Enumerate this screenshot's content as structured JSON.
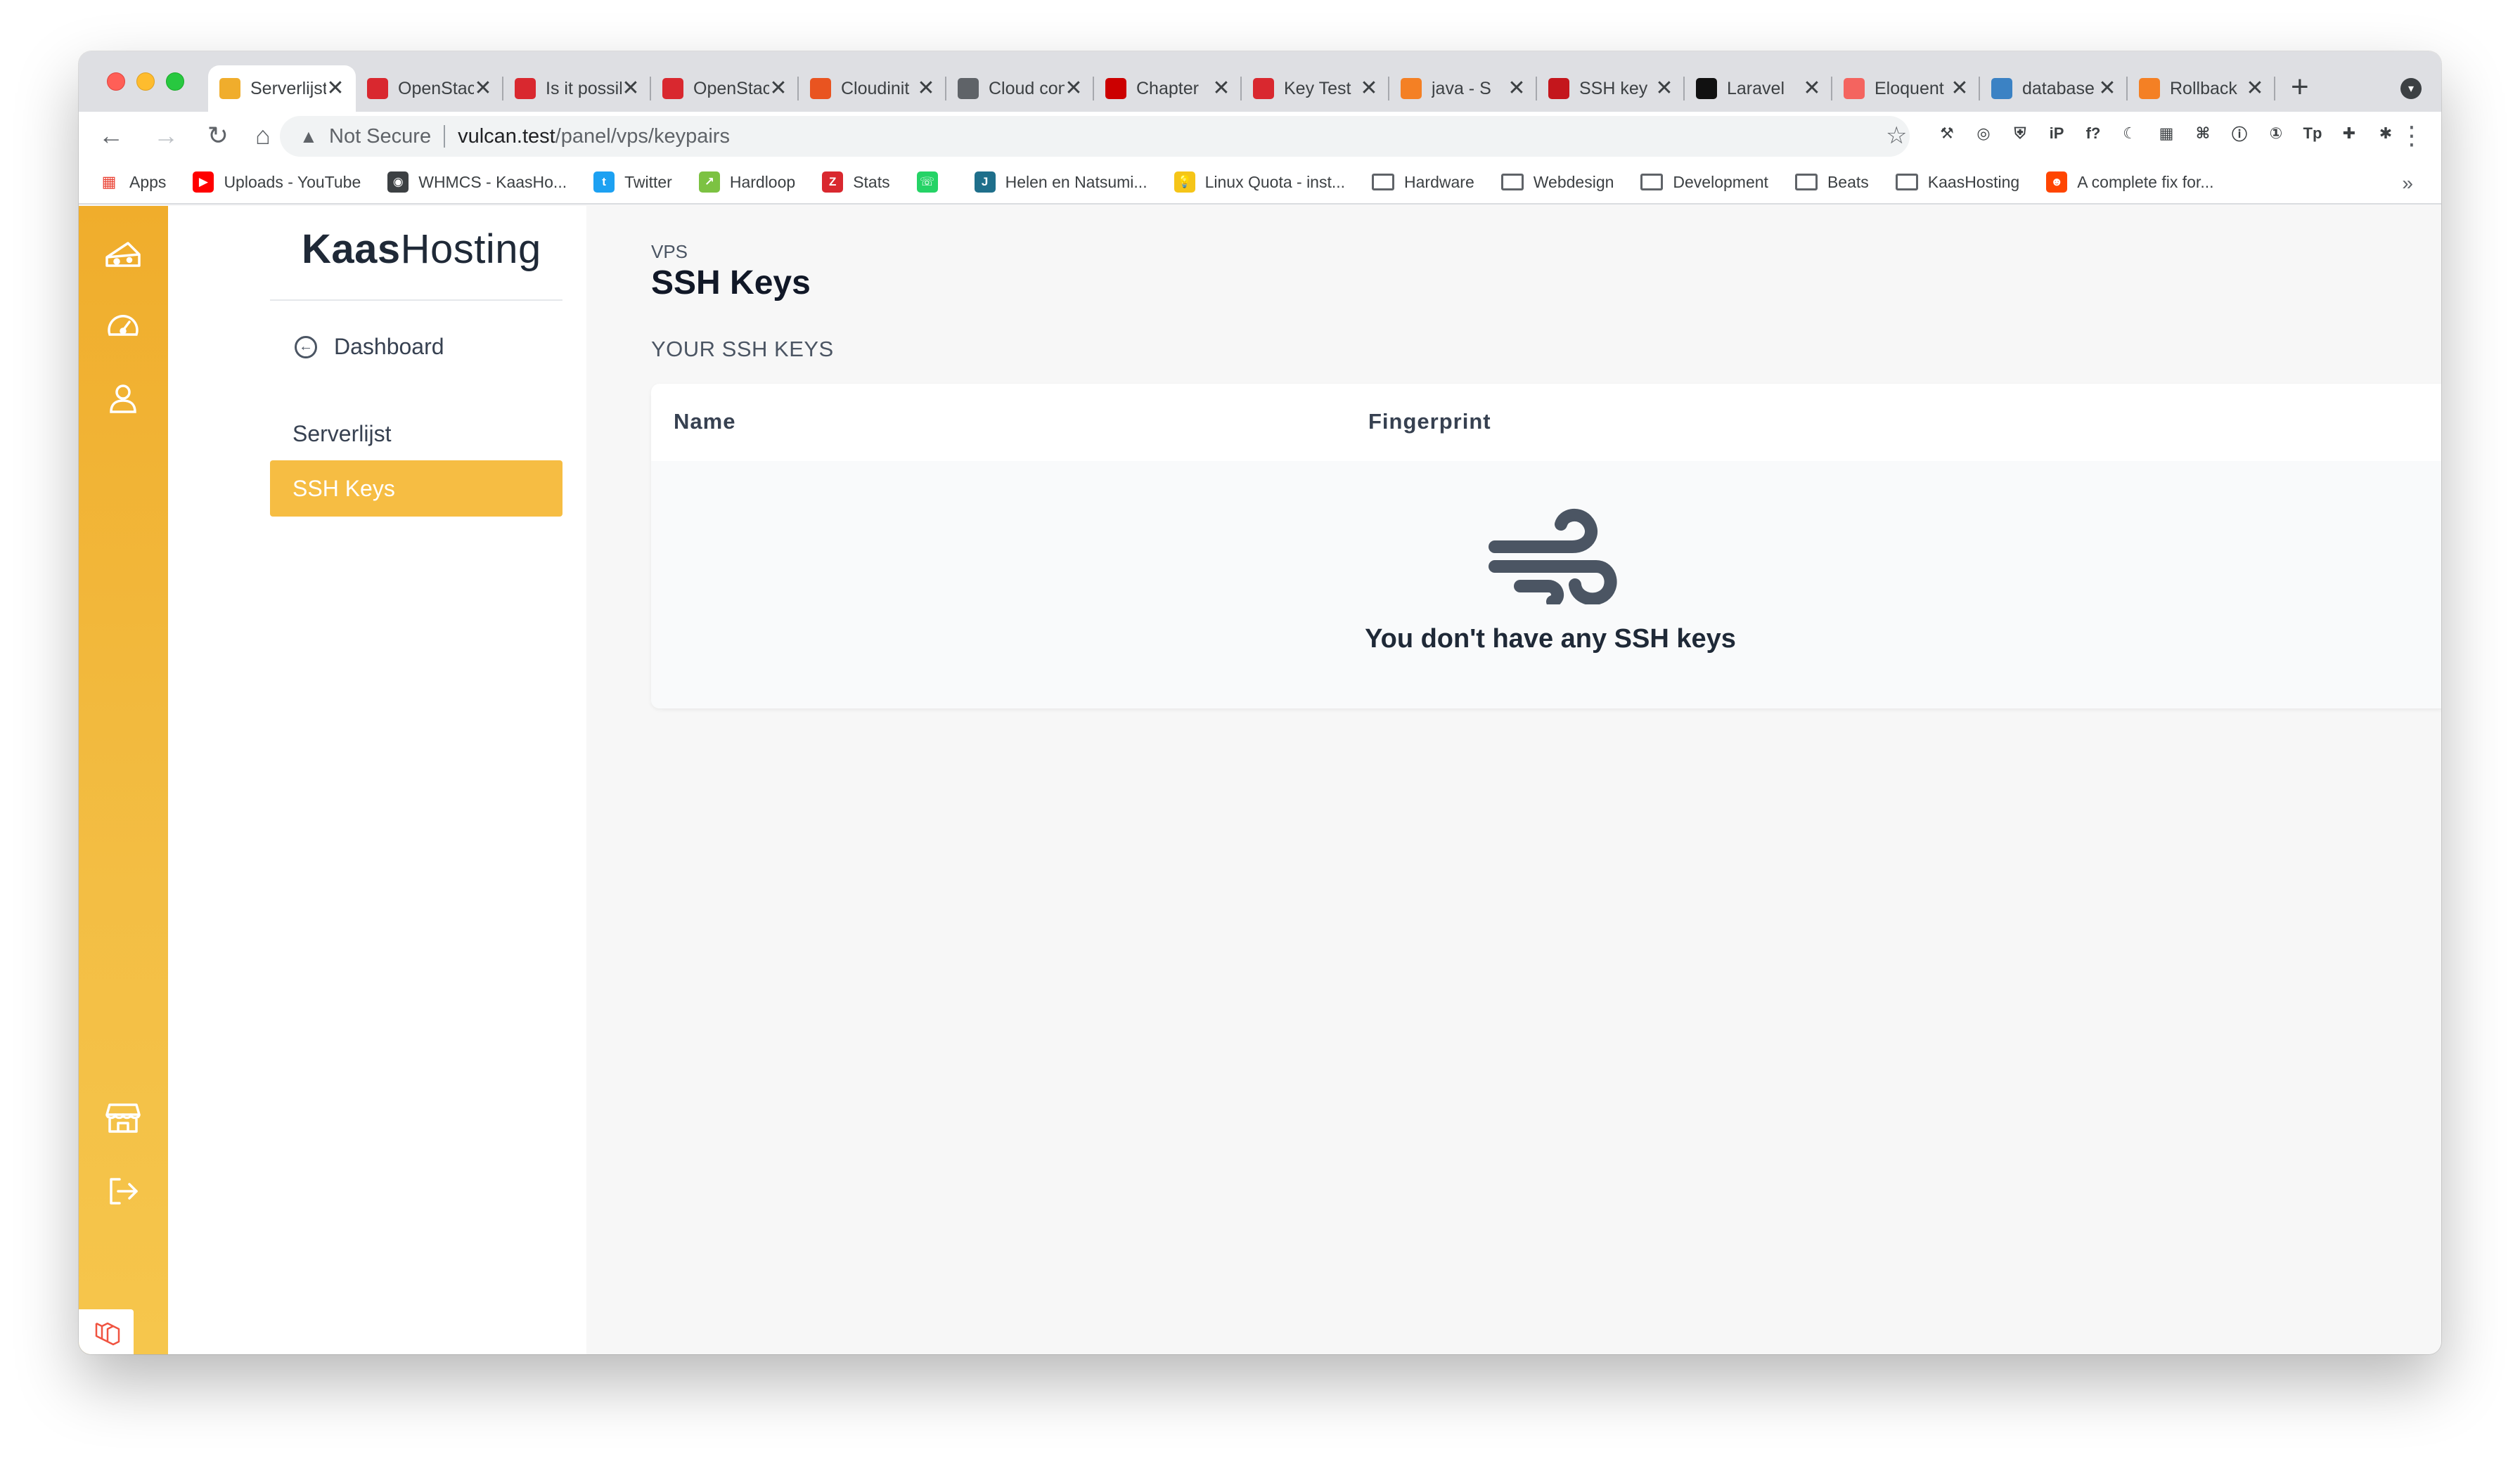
{
  "browser": {
    "tabs": [
      {
        "title": "Serverlijst",
        "favicon_color": "#f0ad2c",
        "active": true
      },
      {
        "title": "OpenStack",
        "favicon_color": "#d9282f",
        "active": false
      },
      {
        "title": "Is it possible",
        "favicon_color": "#d9282f",
        "active": false
      },
      {
        "title": "OpenStack",
        "favicon_color": "#d9282f",
        "active": false
      },
      {
        "title": "Cloudinit",
        "favicon_color": "#e95420",
        "active": false
      },
      {
        "title": "Cloud config",
        "favicon_color": "#5f6368",
        "active": false
      },
      {
        "title": "Chapter",
        "favicon_color": "#cc0000",
        "active": false
      },
      {
        "title": "Key Test",
        "favicon_color": "#d9282f",
        "active": false
      },
      {
        "title": "java - S",
        "favicon_color": "#f48024",
        "active": false
      },
      {
        "title": "SSH key",
        "favicon_color": "#c4161c",
        "active": false
      },
      {
        "title": "Laravel",
        "favicon_color": "#111111",
        "active": false
      },
      {
        "title": "Eloquent",
        "favicon_color": "#f4645f",
        "active": false
      },
      {
        "title": "database",
        "favicon_color": "#3b82c4",
        "active": false
      },
      {
        "title": "Rollback",
        "favicon_color": "#f48024",
        "active": false
      }
    ],
    "tab_close_glyph": "✕",
    "new_tab_glyph": "+",
    "address": {
      "security_label": "Not Secure",
      "host": "vulcan.test",
      "path": "/panel/vps/keypairs"
    },
    "extensions": [
      "⚒",
      "◎",
      "⛨",
      "iP",
      "f?",
      "☾",
      "▦",
      "⌘",
      "ⓘ",
      "①",
      "Tp",
      "✚",
      "✱"
    ],
    "bookmarks": [
      {
        "label": "Apps",
        "kind": "apps",
        "color": "#ea4335"
      },
      {
        "label": "Uploads - YouTube",
        "kind": "icon",
        "color": "#ff0000",
        "glyph": "▶"
      },
      {
        "label": "WHMCS - KaasHo...",
        "kind": "icon",
        "color": "#3c4043",
        "glyph": "◉"
      },
      {
        "label": "Twitter",
        "kind": "icon",
        "color": "#1da1f2",
        "glyph": "t"
      },
      {
        "label": "Hardloop",
        "kind": "icon",
        "color": "#7cc242",
        "glyph": "↗"
      },
      {
        "label": "Stats",
        "kind": "icon",
        "color": "#d9282f",
        "glyph": "Z"
      },
      {
        "label": "",
        "kind": "icon",
        "color": "#25d366",
        "glyph": "☏"
      },
      {
        "label": "Helen en Natsumi...",
        "kind": "icon",
        "color": "#1f6f8b",
        "glyph": "J"
      },
      {
        "label": "Linux Quota - inst...",
        "kind": "icon",
        "color": "#f5c518",
        "glyph": "💡"
      },
      {
        "label": "Hardware",
        "kind": "folder"
      },
      {
        "label": "Webdesign",
        "kind": "folder"
      },
      {
        "label": "Development",
        "kind": "folder"
      },
      {
        "label": "Beats",
        "kind": "folder"
      },
      {
        "label": "KaasHosting",
        "kind": "folder"
      },
      {
        "label": "A complete fix for...",
        "kind": "icon",
        "color": "#ff4500",
        "glyph": "☻"
      }
    ],
    "bookmarks_more": "»"
  },
  "app": {
    "brand_bold": "Kaas",
    "brand_light": "Hosting",
    "sidebar": {
      "dashboard_label": "Dashboard",
      "items": [
        {
          "label": "Serverlijst",
          "active": false
        },
        {
          "label": "SSH Keys",
          "active": true
        }
      ]
    },
    "breadcrumb": "VPS",
    "title": "SSH Keys",
    "section_label": "YOUR SSH KEYS",
    "table": {
      "columns": [
        "Name",
        "Fingerprint"
      ]
    },
    "empty_state": {
      "message": "You don't have any SSH keys",
      "icon": "wind-icon"
    },
    "colors": {
      "accent": "#f6bd43",
      "rail_top": "#f0ad2c",
      "text": "#1f2937"
    }
  }
}
